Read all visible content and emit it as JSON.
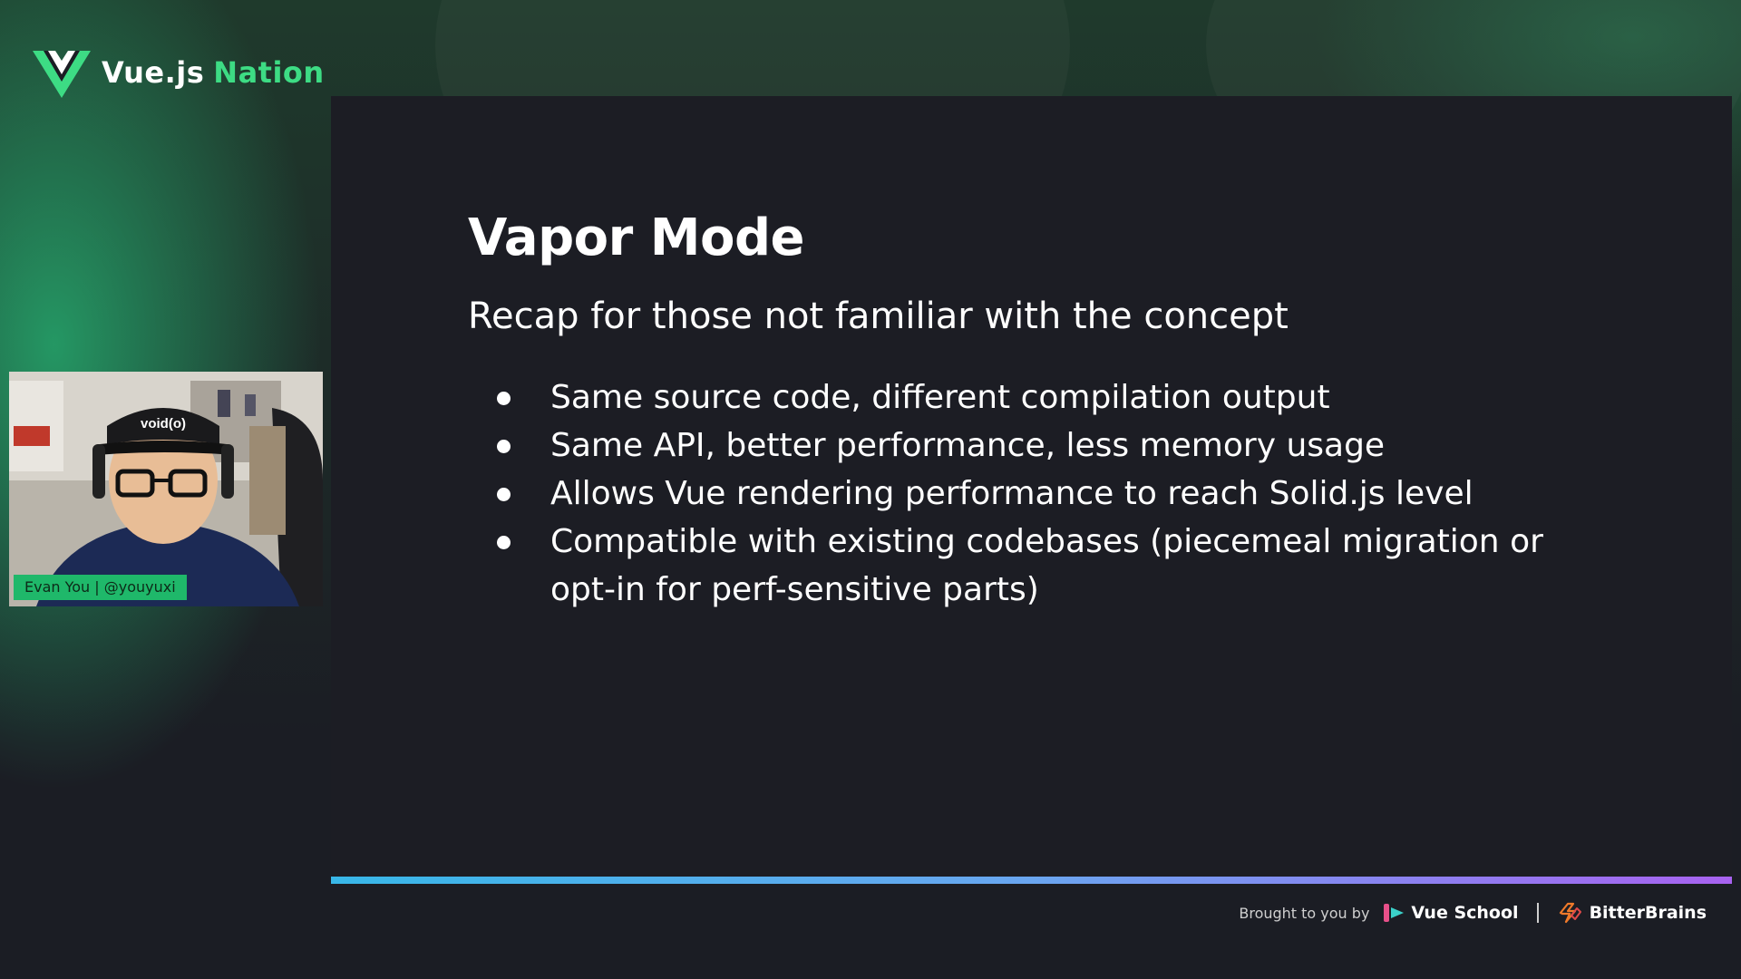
{
  "header": {
    "logo_word1": "Vue.js",
    "logo_word2": "Nation"
  },
  "slide": {
    "title": "Vapor Mode",
    "subtitle": "Recap for those not familiar with the concept",
    "bullets": [
      "Same source code, different compilation output",
      "Same API, better performance, less memory usage",
      "Allows Vue rendering performance to reach Solid.js level",
      "Compatible with existing codebases (piecemeal migration or opt-in for perf-sensitive parts)"
    ]
  },
  "presenter": {
    "name_tag": "Evan You | @youyuxi",
    "cap_text": "void(o)"
  },
  "progress": {
    "fraction": 1.0
  },
  "footer": {
    "brought_by": "Brought to you by",
    "sponsor1": "Vue School",
    "sponsor2": "BitterBrains"
  },
  "colors": {
    "accent_green": "#3ddc84",
    "progress_start": "#38b7e8",
    "progress_end": "#a862f0",
    "slide_bg": "#1c1d24"
  },
  "icons": [
    "vue-logo-icon",
    "bullet-dot-icon",
    "vue-school-logo-icon",
    "bitterbrains-logo-icon"
  ]
}
